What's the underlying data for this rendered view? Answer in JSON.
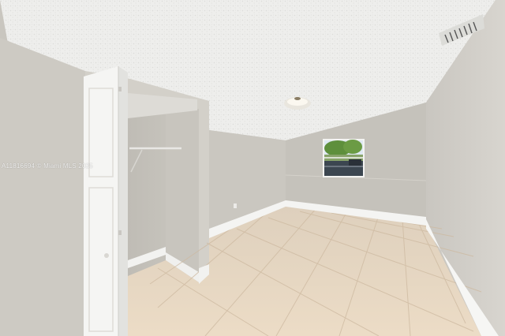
{
  "watermark": "A11816694 © Miami MLS 2025",
  "colors": {
    "ceiling": "#efefed",
    "wall_left": "#cfccc5",
    "wall_back": "#c6c3bc",
    "wall_right": "#d2cfc9",
    "floor": "#e7d6c0",
    "grout": "#c9b49a",
    "baseboard": "#f4f4f2",
    "door": "#f6f6f4",
    "window_sky": "#dfe9f2",
    "window_trees": "#5e8f3c"
  }
}
